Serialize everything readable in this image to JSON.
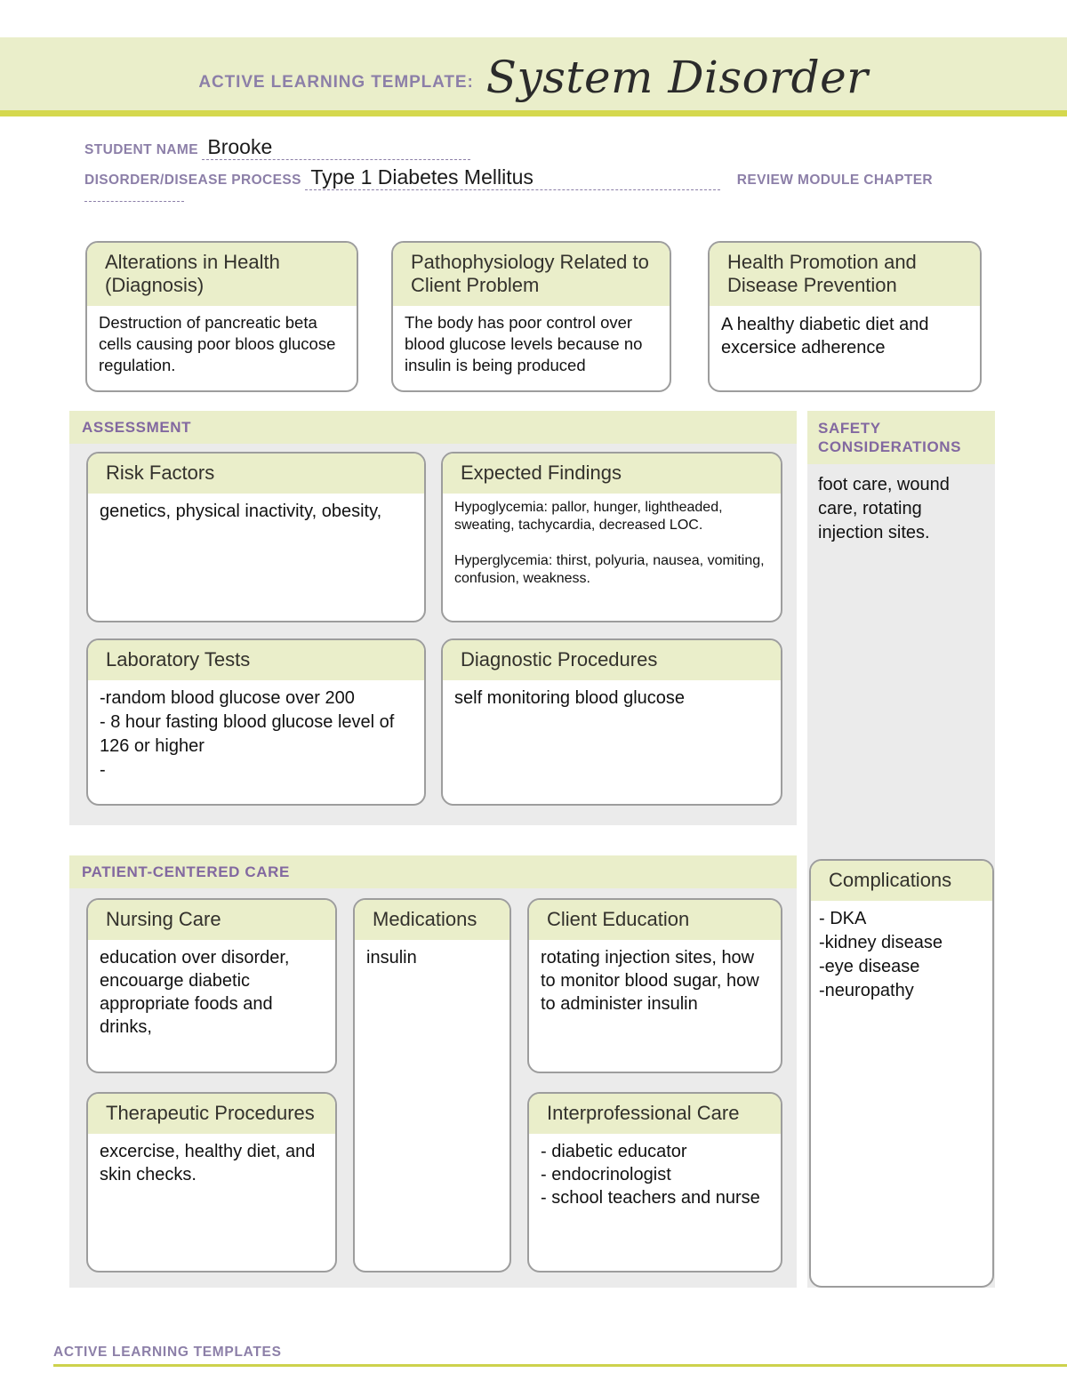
{
  "header": {
    "kicker": "ACTIVE LEARNING TEMPLATE:",
    "title": "System Disorder"
  },
  "meta": {
    "student_name_label": "STUDENT NAME",
    "student_name_value": "Brooke",
    "disorder_label": "DISORDER/DISEASE PROCESS",
    "disorder_value": "Type 1 Diabetes Mellitus",
    "chapter_label": "REVIEW MODULE CHAPTER",
    "chapter_value": ""
  },
  "top_cards": {
    "alterations": {
      "title": "Alterations in\nHealth (Diagnosis)",
      "body": "Destruction of pancreatic beta cells causing poor bloos glucose regulation."
    },
    "pathophysiology": {
      "title": "Pathophysiology Related\nto Client Problem",
      "body": "The body has poor control over blood glucose levels because no insulin is being produced"
    },
    "health_promotion": {
      "title": "Health Promotion and\nDisease Prevention",
      "body": "A healthy diabetic diet and excersice adherence"
    }
  },
  "assessment": {
    "section_title": "ASSESSMENT",
    "risk_factors": {
      "title": "Risk Factors",
      "body": "genetics, physical inactivity, obesity,"
    },
    "expected_findings": {
      "title": "Expected Findings",
      "body": "Hypoglycemia: pallor, hunger, lightheaded, sweating, tachycardia, decreased LOC.\n\nHyperglycemia: thirst, polyuria, nausea, vomiting, confusion, weakness."
    },
    "laboratory_tests": {
      "title": "Laboratory Tests",
      "body": "-random blood glucose over 200\n- 8 hour fasting blood glucose level of 126 or higher\n-"
    },
    "diagnostic_procedures": {
      "title": "Diagnostic Procedures",
      "body": "self monitoring blood glucose"
    }
  },
  "safety": {
    "section_title": "SAFETY\nCONSIDERATIONS",
    "body": "foot care, wound care, rotating injection sites."
  },
  "complications": {
    "title": "Complications",
    "body": "- DKA\n-kidney disease\n-eye disease\n-neuropathy"
  },
  "patient_centered_care": {
    "section_title": "PATIENT-CENTERED CARE",
    "nursing_care": {
      "title": "Nursing Care",
      "body": "education over disorder, encouarge diabetic appropriate foods and drinks,"
    },
    "medications": {
      "title": "Medications",
      "body": "insulin"
    },
    "client_education": {
      "title": "Client Education",
      "body": "rotating injection sites, how to monitor blood sugar, how to administer insulin"
    },
    "therapeutic_procedures": {
      "title": "Therapeutic Procedures",
      "body": "excercise, healthy diet, and skin checks."
    },
    "interprofessional_care": {
      "title": "Interprofessional Care",
      "body": "- diabetic educator\n- endocrinologist\n- school teachers and nurse"
    }
  },
  "footer": {
    "text": "ACTIVE LEARNING TEMPLATES"
  },
  "colors": {
    "band": "#eaeeca",
    "stripe": "#d5d84e",
    "accent_purple": "#8c7fa8",
    "panel_gray": "#ebebeb",
    "card_border": "#9d9d9d"
  }
}
